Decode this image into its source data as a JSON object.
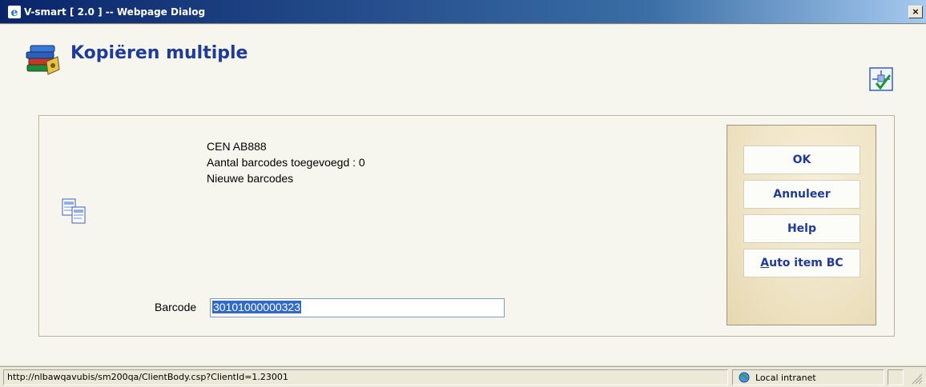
{
  "window": {
    "title": "V-smart [ 2.0 ] -- Webpage Dialog",
    "close_label": "×"
  },
  "header": {
    "page_title": "Kopiëren multiple",
    "header_icon": "books-icon",
    "workflow_icon": "workflow-check-icon"
  },
  "info": {
    "line1": "CEN AB888",
    "line2": "Aantal barcodes toegevoegd : 0",
    "line3": "Nieuwe barcodes",
    "side_icon": "copy-documents-icon"
  },
  "form": {
    "barcode_label": "Barcode",
    "barcode_value": "30101000000323"
  },
  "buttons": {
    "ok": "OK",
    "cancel": "Annuleer",
    "help": "Help",
    "auto_prefix": "A",
    "auto_rest": "uto item BC"
  },
  "statusbar": {
    "url": "http://nlbawqavubis/sm200qa/ClientBody.csp?ClientId=1.23001",
    "zone": "Local intranet"
  },
  "colors": {
    "title_blue": "#1f3b9a",
    "selection": "#316ac5"
  }
}
